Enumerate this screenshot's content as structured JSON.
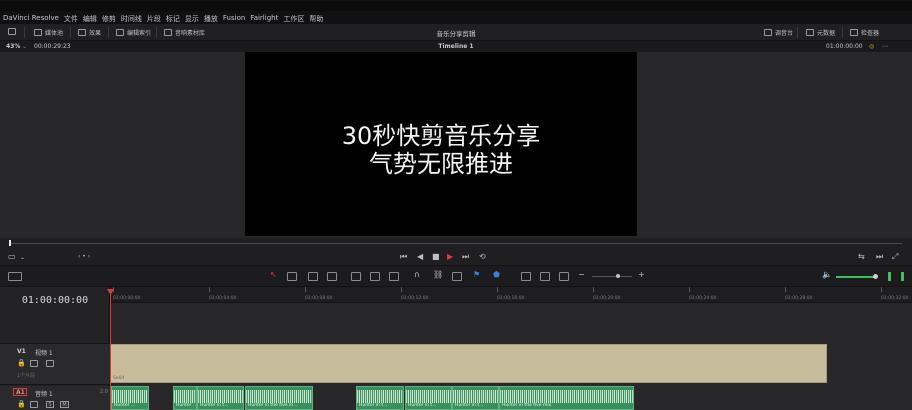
{
  "menubar": {
    "items": [
      "DaVinci Resolve",
      "文件",
      "编辑",
      "修剪",
      "时间线",
      "片段",
      "标记",
      "显示",
      "播放",
      "Fusion",
      "Fairlight",
      "工作区",
      "帮助"
    ]
  },
  "toolbar": {
    "media_pool": "媒体池",
    "effects": "效果",
    "edit_index": "编辑索引",
    "sound_library": "音响素材库",
    "project_title": "音乐分享剪辑",
    "mixer": "调音台",
    "metadata": "元数据",
    "inspector": "检查器"
  },
  "viewer": {
    "zoom": "43%",
    "source_timecode": "00:00:29:23",
    "timeline_name": "Timeline 1",
    "record_timecode": "01:00:00:00",
    "title_line1": "30秒快剪音乐分享",
    "title_line2": "气势无限推进"
  },
  "timeline": {
    "timecode": "01:00:00:00",
    "ruler": [
      "01:00:00:00",
      "01:00:04:00",
      "01:00:08:00",
      "01:00:12:00",
      "01:00:16:00",
      "01:00:20:00",
      "01:00:24:00",
      "01:00:28:00",
      "01:00:32:00"
    ],
    "tracks": {
      "v1": {
        "id": "V1",
        "name": "视频 1",
        "count": "1个片段",
        "clip": "Solid"
      },
      "a1": {
        "id": "A1",
        "name": "音频 1",
        "level": "2.0",
        "s": "S",
        "m": "M"
      }
    },
    "audio_clips": [
      "Hunter ...",
      "Hunter ...",
      "Hunter in t...",
      "Hunter in the five in...",
      "Hunter in t...",
      "Hunter in t...",
      "Hunter in t...",
      "Hunter in the five mix"
    ]
  },
  "colors": {
    "accent": "#e03a3a",
    "video_clip": "#c7bc9b",
    "audio_clip": "#3a8f5e",
    "level_meter": "#3fc060"
  }
}
